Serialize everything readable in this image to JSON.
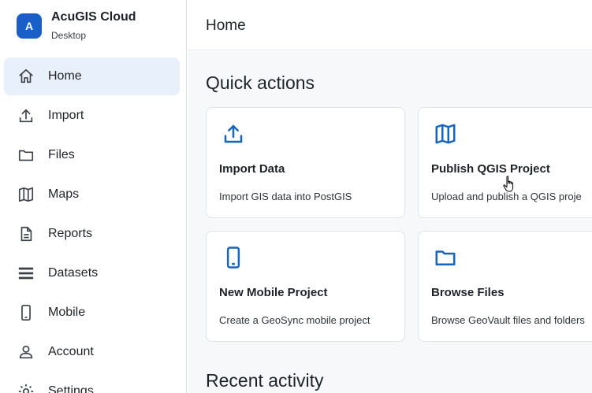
{
  "app": {
    "logo_letter": "A",
    "name": "AcuGIS Cloud",
    "subtitle": "Desktop"
  },
  "sidebar": {
    "items": [
      {
        "label": "Home",
        "icon": "home-icon",
        "active": true
      },
      {
        "label": "Import",
        "icon": "upload-icon"
      },
      {
        "label": "Files",
        "icon": "folder-icon"
      },
      {
        "label": "Maps",
        "icon": "map-icon"
      },
      {
        "label": "Reports",
        "icon": "document-icon"
      },
      {
        "label": "Datasets",
        "icon": "list-icon"
      },
      {
        "label": "Mobile",
        "icon": "phone-icon"
      },
      {
        "label": "Account",
        "icon": "person-icon"
      },
      {
        "label": "Settings",
        "icon": "gear-icon"
      }
    ]
  },
  "header": {
    "title": "Home"
  },
  "main": {
    "quick_actions_title": "Quick actions",
    "recent_activity_title": "Recent activity",
    "cards": [
      {
        "title": "Import Data",
        "description": "Import GIS data into PostGIS",
        "icon": "upload-icon"
      },
      {
        "title": "Publish QGIS Project",
        "description": "Upload and publish a QGIS proje",
        "icon": "map-icon"
      },
      {
        "title": "New Mobile Project",
        "description": "Create a GeoSync mobile project",
        "icon": "phone-icon"
      },
      {
        "title": "Browse Files",
        "description": "Browse GeoVault files and folders",
        "icon": "folder-icon"
      }
    ]
  },
  "colors": {
    "accent": "#1a5fc8",
    "active_nav_bg": "#e8f0fb",
    "icon_blue": "#1565c0"
  }
}
